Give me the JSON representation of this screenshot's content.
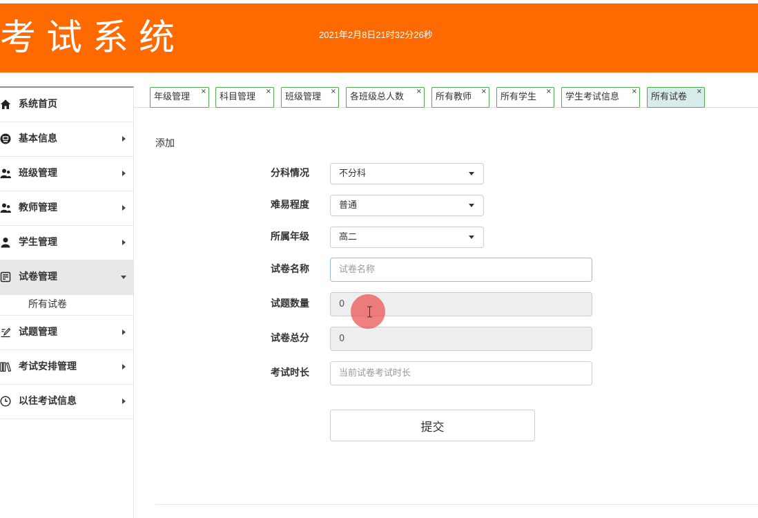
{
  "header": {
    "title": "考试系统",
    "datetime": "2021年2月8日21时32分26秒"
  },
  "colors": {
    "header_bg": "#FF6A00",
    "tab_border": "#4cae4c",
    "tab_active_bg": "#d7ebea",
    "sidebar_active_bg": "#e8e8e8",
    "focus_border": "#92bce6",
    "cursor_highlight": "rgba(236,80,80,0.72)"
  },
  "sidebar": {
    "items": [
      {
        "label": "系统首页",
        "icon": "home-icon"
      },
      {
        "label": "基本信息",
        "icon": "monitor-icon",
        "arrow_icon": "caret-right-icon"
      },
      {
        "label": "班级管理",
        "icon": "users-icon",
        "arrow_icon": "caret-right-icon"
      },
      {
        "label": "教师管理",
        "icon": "users-icon",
        "arrow_icon": "caret-right-icon"
      },
      {
        "label": "学生管理",
        "icon": "user-icon",
        "arrow_icon": "caret-right-icon"
      },
      {
        "label": "试卷管理",
        "icon": "list-alt-icon",
        "arrow_icon": "caret-down-icon",
        "active": true,
        "expanded": true,
        "children": [
          {
            "label": "所有试卷"
          }
        ]
      },
      {
        "label": "试题管理",
        "icon": "edit-icon",
        "arrow_icon": "caret-right-icon"
      },
      {
        "label": "考试安排管理",
        "icon": "books-icon",
        "arrow_icon": "caret-right-icon"
      },
      {
        "label": "以往考试信息",
        "icon": "clock-icon",
        "arrow_icon": "caret-right-icon"
      }
    ]
  },
  "tabs": {
    "close_glyph": "×",
    "items": [
      {
        "label": "年级管理"
      },
      {
        "label": "科目管理"
      },
      {
        "label": "班级管理"
      },
      {
        "label": "各班级总人数"
      },
      {
        "label": "所有教师"
      },
      {
        "label": "所有学生"
      },
      {
        "label": "学生考试信息"
      },
      {
        "label": "所有试卷",
        "active": true
      }
    ]
  },
  "form": {
    "section_title": "添加",
    "fields": [
      {
        "label": "分科情况",
        "value": "不分科"
      },
      {
        "label": "难易程度",
        "value": "普通"
      },
      {
        "label": "所属年级",
        "value": "高二"
      },
      {
        "label": "试卷名称",
        "placeholder": "试卷名称",
        "focused": true
      },
      {
        "label": "试题数量",
        "value": "0",
        "disabled": true
      },
      {
        "label": "试卷总分",
        "value": "0",
        "disabled": true
      },
      {
        "label": "考试时长",
        "placeholder": "当前试卷考试时长"
      }
    ],
    "submit_label": "提交"
  }
}
